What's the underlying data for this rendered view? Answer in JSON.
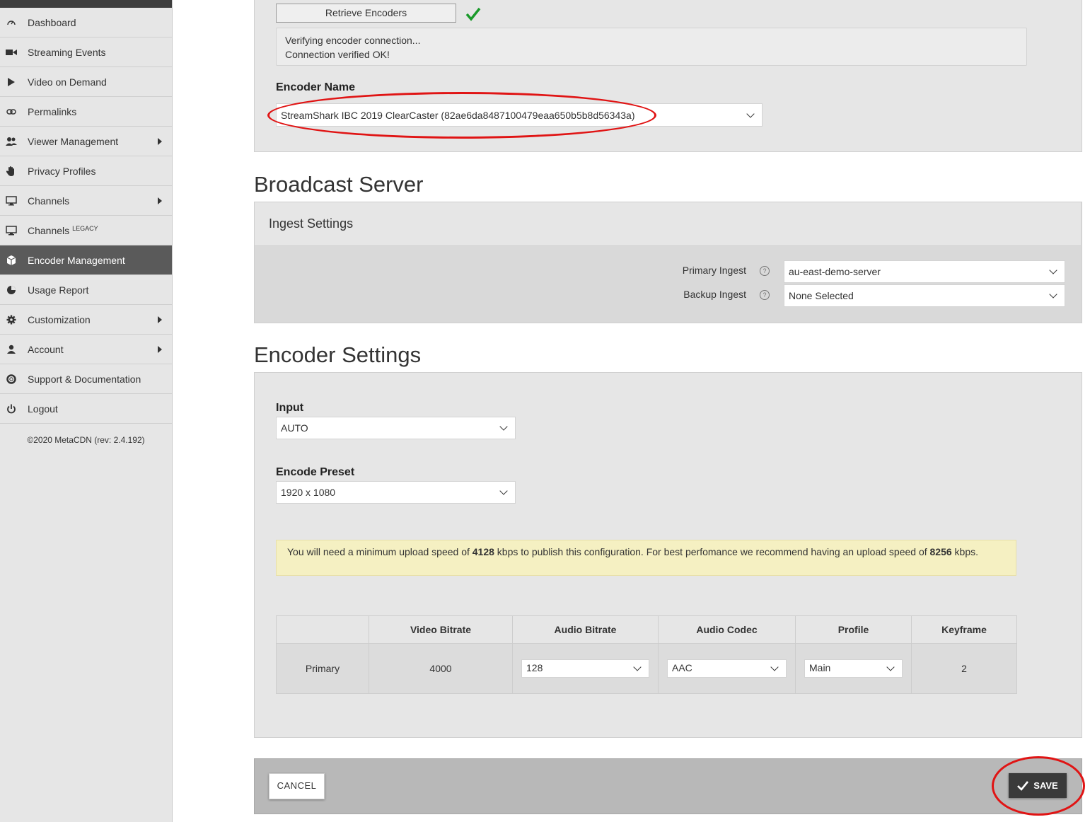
{
  "sidebar": {
    "items": [
      {
        "label": "Dashboard",
        "icon": "dashboard-icon"
      },
      {
        "label": "Streaming Events",
        "icon": "camera-icon"
      },
      {
        "label": "Video on Demand",
        "icon": "play-icon"
      },
      {
        "label": "Permalinks",
        "icon": "link-icon"
      },
      {
        "label": "Viewer Management",
        "icon": "users-icon"
      },
      {
        "label": "Privacy Profiles",
        "icon": "hand-icon"
      },
      {
        "label": "Channels",
        "icon": "monitor-icon"
      },
      {
        "label": "Channels",
        "badge": "LEGACY",
        "icon": "monitor-icon"
      },
      {
        "label": "Encoder Management",
        "icon": "cube-icon"
      },
      {
        "label": "Usage Report",
        "icon": "pie-chart-icon"
      },
      {
        "label": "Customization",
        "icon": "gear-icon"
      },
      {
        "label": "Account",
        "icon": "user-icon"
      },
      {
        "label": "Support & Documentation",
        "icon": "lifebuoy-icon"
      },
      {
        "label": "Logout",
        "icon": "power-icon"
      }
    ],
    "copyright": "©2020 MetaCDN (rev: 2.4.192)"
  },
  "encoder_panel": {
    "retrieve_button": "Retrieve Encoders",
    "status_lines": [
      "Verifying encoder connection...",
      "Connection verified OK!"
    ],
    "encoder_name_label": "Encoder Name",
    "encoder_name_value": "StreamShark IBC 2019 ClearCaster (82ae6da8487100479eaa650b5b8d56343a)"
  },
  "broadcast_server": {
    "title": "Broadcast Server",
    "subheader": "Ingest Settings",
    "primary_label": "Primary Ingest",
    "primary_value": "au-east-demo-server",
    "backup_label": "Backup Ingest",
    "backup_value": "None Selected",
    "help_glyph": "?"
  },
  "encoder_settings": {
    "title": "Encoder Settings",
    "input_label": "Input",
    "input_value": "AUTO",
    "preset_label": "Encode Preset",
    "preset_value": "1920 x 1080",
    "alert": {
      "part1": "You will need a minimum upload speed of ",
      "min_speed": "4128",
      "part2": " kbps to publish this configuration. For best perfomance we recommend having an upload speed of ",
      "rec_speed": "8256",
      "part3": " kbps."
    },
    "table": {
      "headers": [
        "",
        "Video Bitrate",
        "Audio Bitrate",
        "Audio Codec",
        "Profile",
        "Keyframe"
      ],
      "row": {
        "name": "Primary",
        "video_bitrate": "4000",
        "audio_bitrate": "128",
        "audio_codec": "AAC",
        "profile": "Main",
        "keyframe": "2"
      }
    }
  },
  "footer": {
    "cancel_label": "CANCEL",
    "save_label": "SAVE"
  },
  "colors": {
    "annotation": "#e01414",
    "checkmark": "#1a9a2a",
    "active_nav": "#5a5a5a",
    "alert_bg": "#f5f0c2"
  }
}
